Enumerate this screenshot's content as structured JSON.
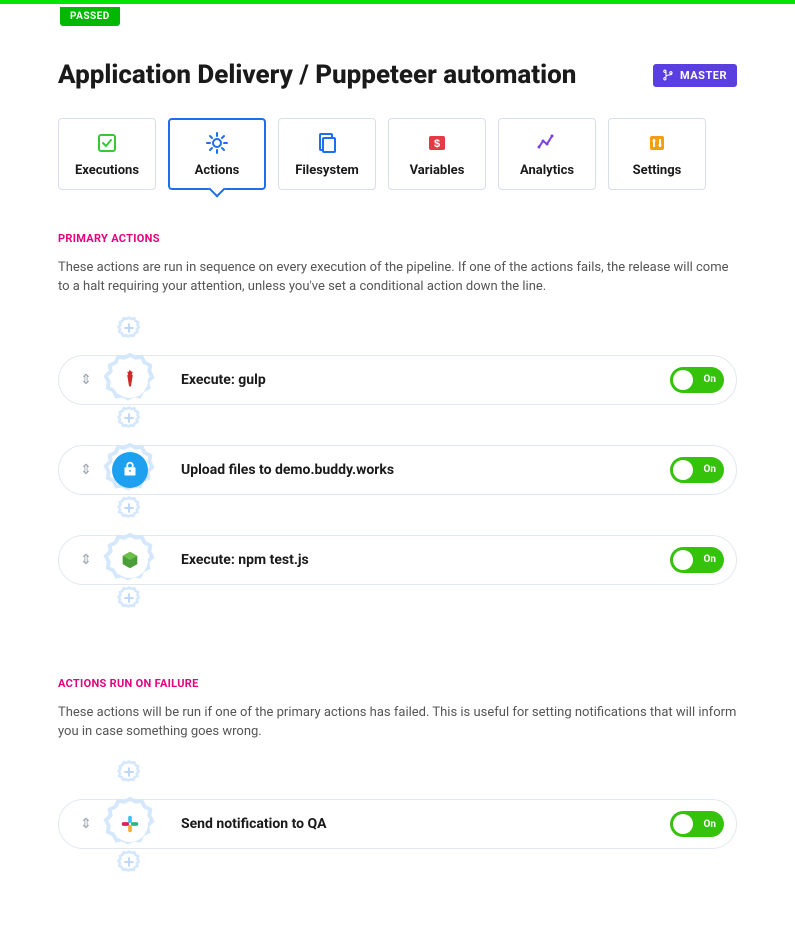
{
  "status_badge": "PASSED",
  "title": "Application Delivery / Puppeteer automation",
  "branch_badge": "MASTER",
  "tabs": [
    {
      "label": "Executions"
    },
    {
      "label": "Actions"
    },
    {
      "label": "Filesystem"
    },
    {
      "label": "Variables"
    },
    {
      "label": "Analytics"
    },
    {
      "label": "Settings"
    }
  ],
  "primary": {
    "header": "PRIMARY ACTIONS",
    "desc": "These actions are run in sequence on every execution of the pipeline. If one of the actions fails, the release will come to a halt requiring your attention, unless you've set a conditional action down the line.",
    "actions": [
      {
        "label": "Execute: gulp",
        "toggle": "On"
      },
      {
        "label": "Upload files to demo.buddy.works",
        "toggle": "On"
      },
      {
        "label": "Execute: npm test.js",
        "toggle": "On"
      }
    ]
  },
  "failure": {
    "header": "ACTIONS RUN ON FAILURE",
    "desc": "These actions will be run if one of the primary actions has failed. This is useful for setting notifications that will inform you in case something goes wrong.",
    "actions": [
      {
        "label": "Send notification to QA",
        "toggle": "On"
      }
    ]
  }
}
